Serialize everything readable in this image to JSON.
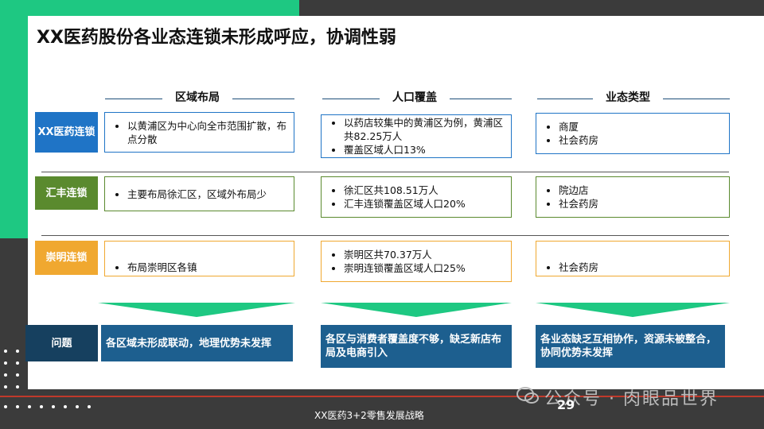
{
  "title": "XX医药股份各业态连锁未形成呼应，协调性弱",
  "columns": [
    "区域布局",
    "人口覆盖",
    "业态类型"
  ],
  "rows": [
    {
      "label": "XX医药连锁",
      "label_color": "#1f74c6",
      "region": [
        "以黄浦区为中心向全市范围扩散，布点分散"
      ],
      "population": [
        "以药店较集中的黄浦区为例，黄浦区共82.25万人",
        "覆盖区域人口13%"
      ],
      "format": [
        "商厦",
        "社会药房"
      ]
    },
    {
      "label": "汇丰连锁",
      "label_color": "#5a8a2e",
      "region": [
        "主要布局徐汇区，区域外布局少"
      ],
      "population": [
        "徐汇区共108.51万人",
        "汇丰连锁覆盖区域人口20%"
      ],
      "format": [
        "院边店",
        "社会药房"
      ]
    },
    {
      "label": "崇明连锁",
      "label_color": "#f0a830",
      "region": [
        "布局崇明区各镇"
      ],
      "population": [
        "崇明区共70.37万人",
        "崇明连锁覆盖区域人口25%"
      ],
      "format": [
        "社会药房"
      ]
    }
  ],
  "issue_label": "问题",
  "issues": [
    "各区域未形成联动，地理优势未发挥",
    "各区与消费者覆盖度不够，缺乏新店布局及电商引入",
    "各业态缺乏互相协作，资源未被整合，协同优势未发挥"
  ],
  "footer": "XX医药3+2零售发展战略",
  "page_number": "29",
  "watermark": "公众号 · 肉眼品世界",
  "colors": {
    "accent_green": "#1ec882",
    "arrow_green": "#1ec882",
    "issue_blue": "#1d5f8f",
    "issue_label_bg": "#16405f"
  }
}
